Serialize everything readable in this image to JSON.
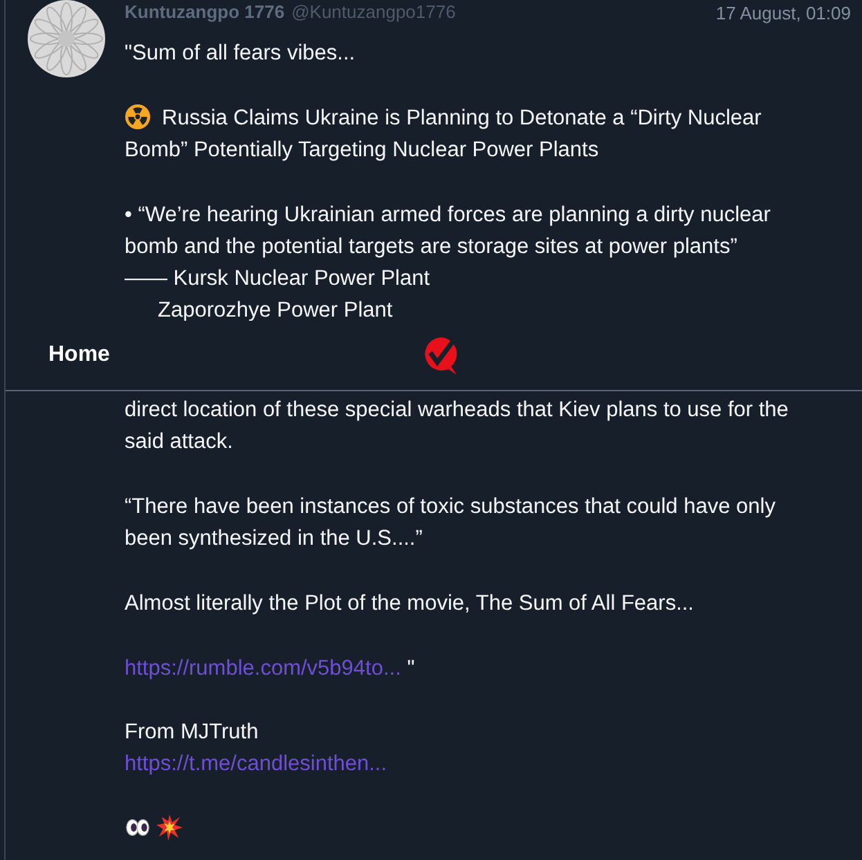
{
  "post": {
    "author": "Kuntuzangpo 1776",
    "handle": "@Kuntuzangpo1776",
    "time": "17 August, 01:09",
    "blocks": [
      {
        "kind": "text",
        "lines": [
          "\"Sum of all fears vibes..."
        ]
      },
      {
        "kind": "radiation",
        "lines": [
          "Russia Claims Ukraine is Planning to Detonate a “Dirty Nuclear",
          "Bomb” Potentially Targeting Nuclear Power Plants"
        ]
      },
      {
        "kind": "text",
        "lines": [
          "• “We’re hearing Ukrainian armed forces are planning a dirty nuclear",
          "bomb and the potential targets are storage sites at power plants”",
          "—— Kursk Nuclear Power Plant"
        ],
        "indented_lines": [
          "Zaporozhye Power Plant"
        ]
      }
    ]
  },
  "nav": {
    "title": "Home"
  },
  "post_continued": {
    "blocks": [
      {
        "kind": "text",
        "lines": [
          "direct location of these special warheads that Kiev plans to use for the",
          "said attack."
        ]
      },
      {
        "kind": "text",
        "lines": [
          "“There have been instances of toxic substances that could have only",
          "been synthesized in the U.S....”"
        ]
      },
      {
        "kind": "text",
        "lines": [
          "Almost literally the Plot of the movie, The Sum of All Fears..."
        ]
      },
      {
        "kind": "link",
        "url": "https://rumble.com/v5b94to...",
        "after": "\""
      },
      {
        "kind": "source",
        "lines": [
          "From MJTruth"
        ],
        "url": "https://t.me/candlesinthen..."
      },
      {
        "kind": "emojis"
      }
    ]
  }
}
